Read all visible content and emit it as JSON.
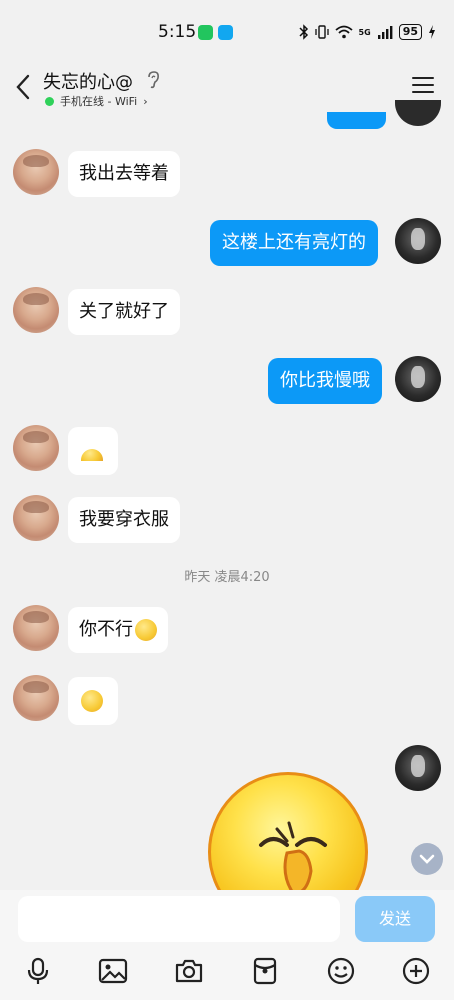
{
  "status_bar": {
    "time": "5:15",
    "battery": "95",
    "network": "5G"
  },
  "header": {
    "contact_name": "失忘的心@",
    "online_status": "手机在线 - WiFi"
  },
  "messages": [
    {
      "side": "left",
      "type": "text",
      "text": "我出去等着"
    },
    {
      "side": "right",
      "type": "text",
      "text": "这楼上还有亮灯的"
    },
    {
      "side": "left",
      "type": "text",
      "text": "关了就好了"
    },
    {
      "side": "right",
      "type": "text",
      "text": "你比我慢哦"
    },
    {
      "side": "left",
      "type": "emoji",
      "emoji": "peeking-face"
    },
    {
      "side": "left",
      "type": "text",
      "text": "我要穿衣服"
    },
    {
      "type": "timestamp",
      "text": "昨天 凌晨4:20"
    },
    {
      "side": "left",
      "type": "text",
      "text": "你不行",
      "emoji": "smirk-face"
    },
    {
      "side": "left",
      "type": "emoji",
      "emoji": "pleading-face"
    },
    {
      "side": "right",
      "type": "sticker",
      "emoji": "big-pinch-face"
    }
  ],
  "input": {
    "placeholder": "",
    "send_label": "发送"
  },
  "toolbar": {
    "items": [
      "microphone-icon",
      "image-icon",
      "camera-icon",
      "red-packet-icon",
      "emoji-icon",
      "plus-icon"
    ]
  },
  "colors": {
    "bubble_right": "#0c99f7",
    "bubble_left": "#ffffff",
    "background": "#f1f1f1",
    "send_button": "#8ac9f8",
    "online_dot": "#2fd15a"
  }
}
